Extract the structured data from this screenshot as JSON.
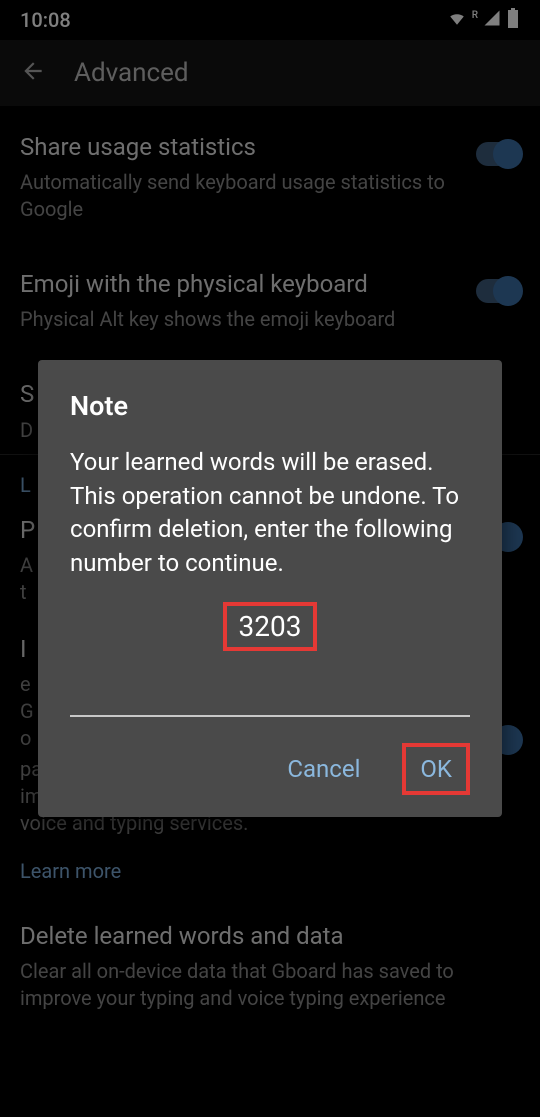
{
  "status": {
    "time": "10:08",
    "signal_badge": "R"
  },
  "header": {
    "title": "Advanced"
  },
  "settings": {
    "share_usage": {
      "title": "Share usage statistics",
      "desc": "Automatically send keyboard usage statistics to Google"
    },
    "emoji_physical": {
      "title": "Emoji with the physical keyboard",
      "desc": "Physical Alt key shows the emoji keyboard"
    },
    "partial_s": {
      "title": "S",
      "desc": "D"
    },
    "section_l": "L",
    "partial_p": {
      "title": "P",
      "desc_line1": "A",
      "desc_line2": "t"
    },
    "partial_i": {
      "title": "I",
      "frag_e": "e",
      "frag_g": "G",
      "frag_o": "o",
      "desc_rest": "patterns. With your permission, Gboard will use these improvements, in the aggregate, to update Google's voice and typing services."
    },
    "learn_more": "Learn more",
    "delete_learned": {
      "title": "Delete learned words and data",
      "desc": "Clear all on-device data that Gboard has saved to improve your typing and voice typing experience"
    }
  },
  "dialog": {
    "title": "Note",
    "message": "Your learned words will be erased. This operation cannot be undone. To confirm deletion, enter the following number to continue.",
    "code": "3203",
    "cancel": "Cancel",
    "ok": "OK"
  }
}
